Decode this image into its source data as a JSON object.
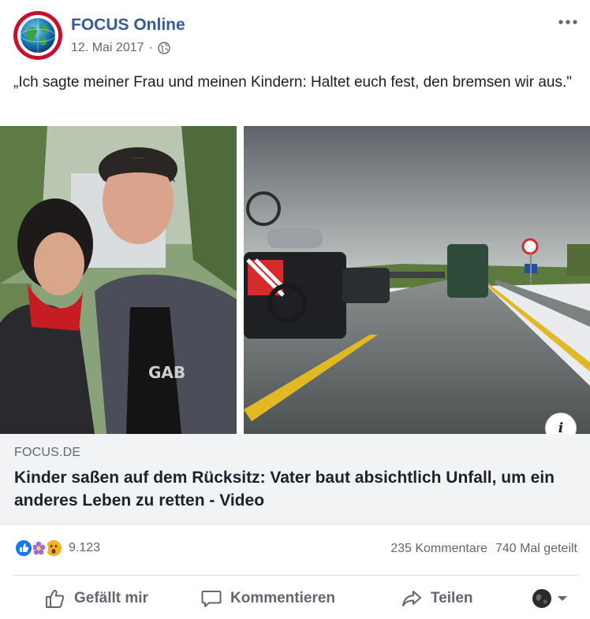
{
  "post": {
    "page_name": "FOCUS Online",
    "date": "12. Mai 2017",
    "separator": "·",
    "audience_icon": "globe-icon",
    "more_icon": "more-dots-icon",
    "text": "„Ich sagte meiner Frau und meinen Kindern: Haltet euch fest, den bremsen wir aus.\""
  },
  "media": {
    "left_photo": "couple-photo",
    "right_photo": "highway-traffic-photo",
    "info_label": "i"
  },
  "link": {
    "domain": "FOCUS.DE",
    "title": "Kinder saßen auf dem Rücksitz: Vater baut absichtlich Unfall, um ein anderes Leben zu retten - Video"
  },
  "stats": {
    "reaction_icons": [
      "like-reaction-icon",
      "flower-reaction-icon",
      "wow-reaction-icon"
    ],
    "reaction_count": "9.123",
    "comments": "235 Kommentare",
    "shares": "740 Mal geteilt"
  },
  "actions": {
    "like": "Gefällt mir",
    "comment": "Kommentieren",
    "share": "Teilen"
  },
  "colors": {
    "brand_blue": "#385898",
    "secondary_text": "#606770",
    "link_bg": "#f2f3f5",
    "avatar_ring": "#c8102e"
  }
}
